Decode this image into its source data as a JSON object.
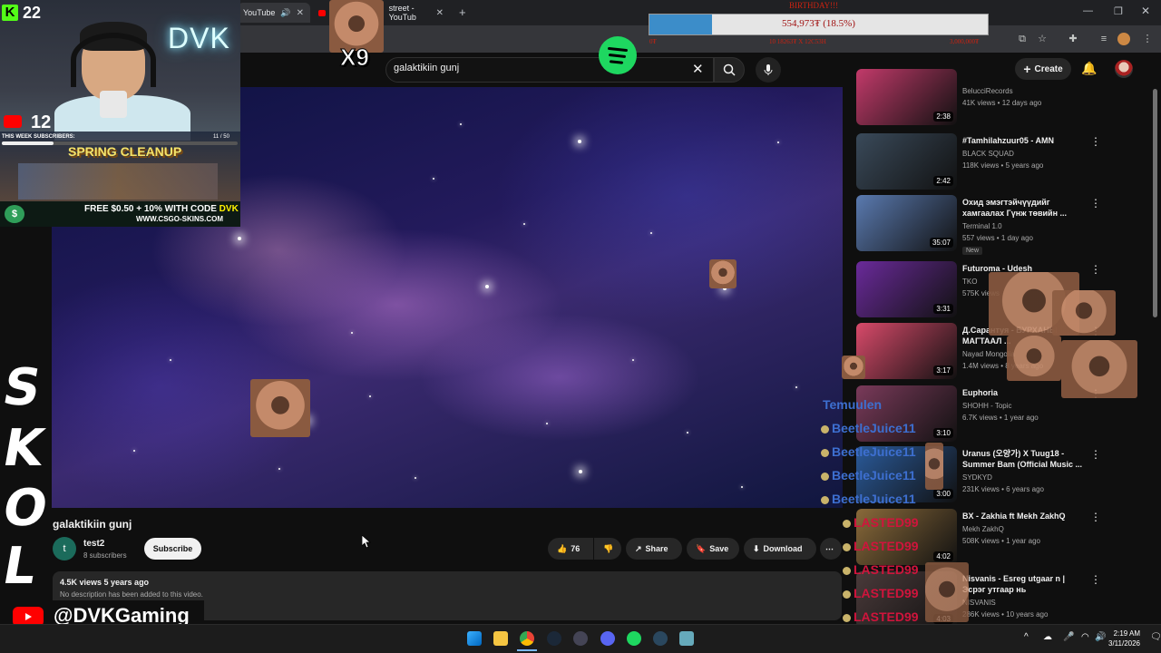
{
  "browser": {
    "tabs": [
      {
        "label": "YouTube"
      },
      {
        "label": "street - YouTub"
      }
    ]
  },
  "youtube": {
    "search_value": "galaktikiin gunj",
    "create_label": "Create"
  },
  "video": {
    "title": "galaktikiin gunj",
    "channel": "test2",
    "subscribers": "8 subscribers",
    "subscribe_label": "Subscribe",
    "likes": "76",
    "share_label": "Share",
    "save_label": "Save",
    "download_label": "Download",
    "stats": "4.5K views  5 years ago",
    "description": "No description has been added to this video."
  },
  "sidebar": {
    "items": [
      {
        "title": "",
        "channel": "BelucciRecords",
        "meta": "41K views • 12 days ago",
        "duration": "2:38",
        "thumb_color": "#c23a6a"
      },
      {
        "title": "#Tamhilahzuur05 - AMN",
        "channel": "BLACK SQUAD",
        "meta": "118K views • 5 years ago",
        "duration": "2:42",
        "thumb_color": "#3a4a5a"
      },
      {
        "title": "Охид эмэгтэйчүүдийг хамгаалах Гүнж төвийн ...",
        "channel": "Terminal 1.0",
        "meta": "557 views • 1 day ago",
        "duration": "35:07",
        "badge": "New",
        "thumb_color": "#5a7ab0"
      },
      {
        "title": "Futuroma -  Udesh",
        "channel": "TKO",
        "meta": "575K views",
        "duration": "3:31",
        "thumb_color": "#6a2a9a"
      },
      {
        "title": "Д.Сарантуя - БУРХАНЫ МАГТААЛ ...",
        "channel": "Nayad Mongolia",
        "meta": "1.4M views • 8 years ago",
        "duration": "3:17",
        "thumb_color": "#d84a6a"
      },
      {
        "title": "Euphoria",
        "channel": "SHOHH - Topic",
        "meta": "6.7K views • 1 year ago",
        "duration": "3:10",
        "thumb_color": "#7a3a5a"
      },
      {
        "title": "Uranus (오양가) X Tuug18 - Summer Bam (Official Music ...",
        "channel": "SYDKYD",
        "meta": "231K views • 6 years ago",
        "duration": "3:00",
        "thumb_color": "#2a5a9a"
      },
      {
        "title": "BX - Zakhia ft Mekh ZakhQ",
        "channel": "Mekh ZakhQ",
        "meta": "508K views • 1 year ago",
        "duration": "4:02",
        "thumb_color": "#8a6a3a"
      },
      {
        "title": "Nisvanis - Esreg utgaar n | Эсрэг утгаар нь",
        "channel": "NISVANIS",
        "meta": "286K views • 10 years ago",
        "duration": "4:03",
        "thumb_color": "#4a3a3a"
      }
    ]
  },
  "overlay": {
    "kick_count": "22",
    "dvk_neon": "DVK",
    "yt_count": "12",
    "week_label": "THIS WEEK SUBSCRIBERS:",
    "week_count": "11 / 50",
    "week_progress": 0.22,
    "spring": "SPRING CLEANUP",
    "promo_line1_a": "FREE $0.50 + 10% WITH CODE",
    "promo_line1_b": "DVK",
    "promo_line2": "WWW.CSGO-SKINS.COM",
    "x9": "X9",
    "goal_head": "BIRTHDAY!!!",
    "goal_text": "554,973₮ (18.5%)",
    "goal_progress": 0.185,
    "goal_left": "0₮",
    "goal_mid": "10 18263₮ X 12C53Н",
    "goal_right": "3,000,000₮",
    "side_letters": [
      "S",
      "K",
      "O",
      "L"
    ],
    "handle": "@DVKGaming",
    "chat": [
      {
        "name": "Temuulen",
        "style": "blue"
      },
      {
        "name": "BeetleJuice11",
        "style": "blue"
      },
      {
        "name": "BeetleJuice11",
        "style": "blue"
      },
      {
        "name": "BeetleJuice11",
        "style": "blue"
      },
      {
        "name": "BeetleJuice11",
        "style": "blue"
      },
      {
        "name": "LASTED99",
        "style": "red"
      },
      {
        "name": "LASTED99",
        "style": "red"
      },
      {
        "name": "LASTED99",
        "style": "red"
      },
      {
        "name": "LASTED99",
        "style": "red"
      },
      {
        "name": "LASTED99",
        "style": "red"
      }
    ]
  },
  "taskbar": {
    "time": "2:19 AM",
    "date": "3/11/2026"
  }
}
